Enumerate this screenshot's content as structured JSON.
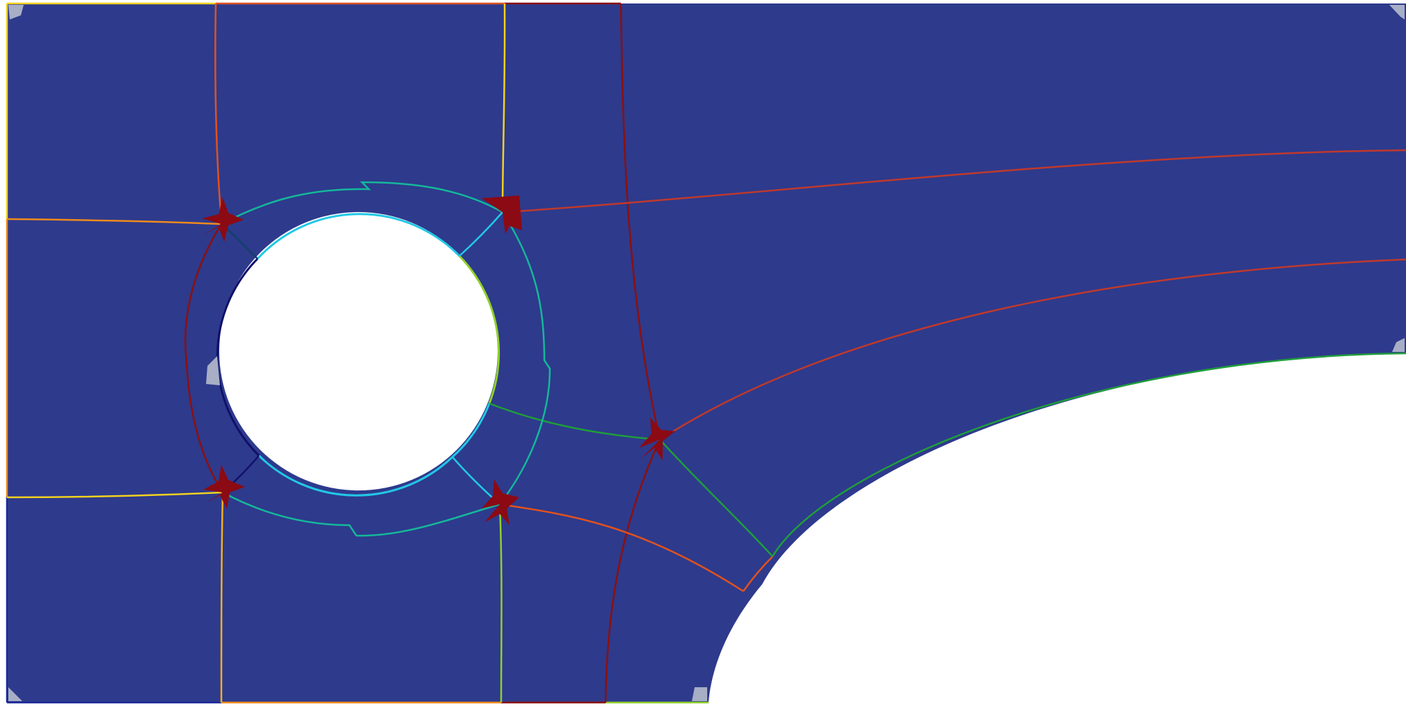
{
  "colors": {
    "background": "#ffffff",
    "domain_fill": "#2e3a8c",
    "singularity_marker": "#8b0a14",
    "corner_marker": "#a7aec6",
    "separatrix_yellow": "#f2d21e",
    "separatrix_orange": "#f08a1c",
    "separatrix_orange_red": "#e0521e",
    "separatrix_red": "#c0392b",
    "separatrix_dark_red": "#8a1010",
    "separatrix_green": "#1f9e3a",
    "separatrix_teal": "#14b89a",
    "separatrix_cyan": "#22c8e6",
    "separatrix_navy": "#10106a",
    "separatrix_lime": "#8fd12a"
  },
  "icons": {
    "singularity": "star-singularity-icon",
    "corner": "corner-marker-icon"
  }
}
